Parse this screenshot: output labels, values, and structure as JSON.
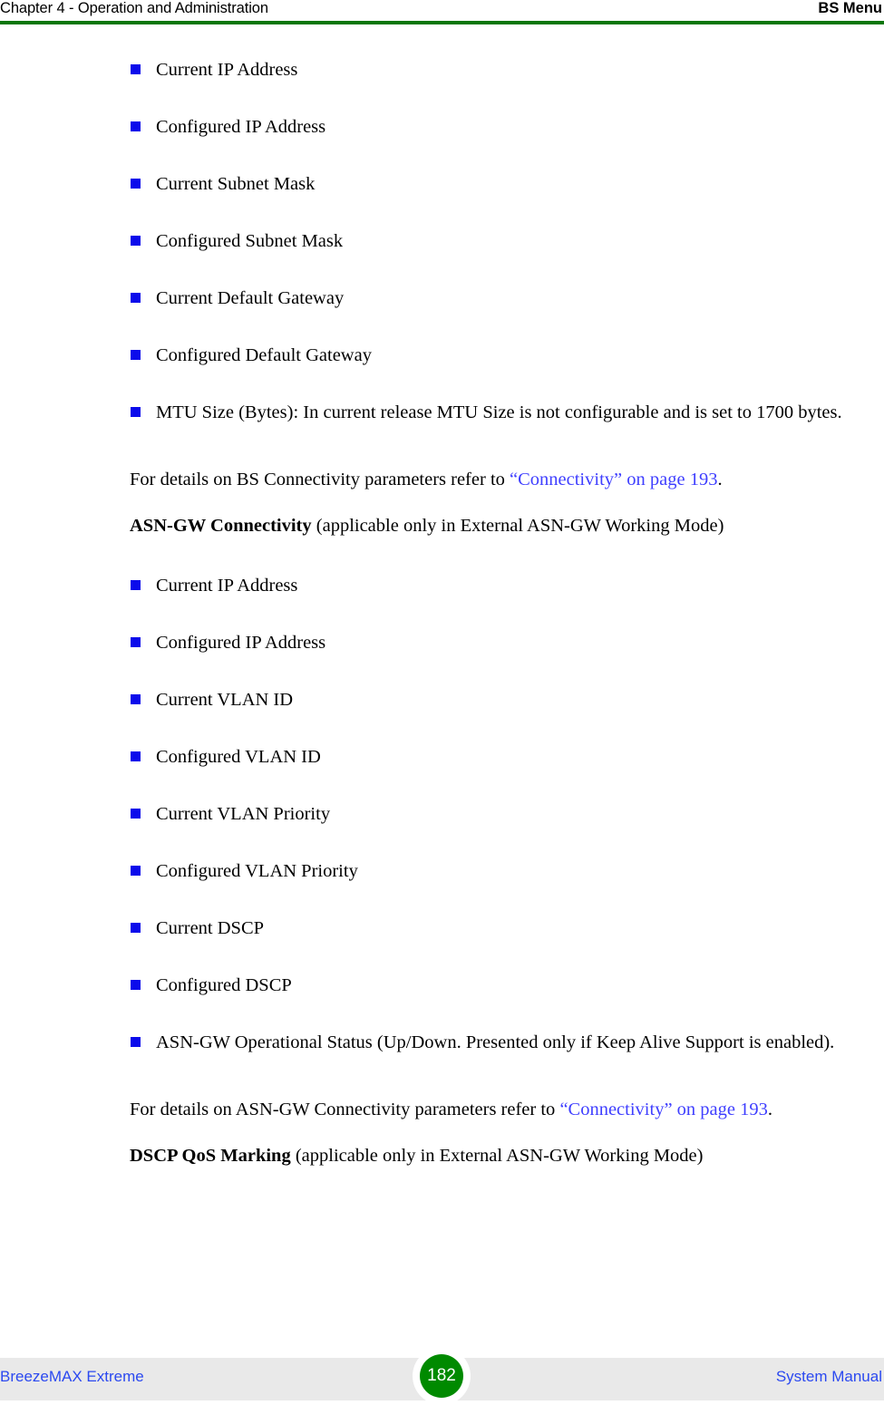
{
  "header": {
    "left": "Chapter 4 - Operation and Administration",
    "right": "BS Menu",
    "rule_color": "#097609"
  },
  "bullet_color": "#0b0beb",
  "link_color": "#3f3fff",
  "bs_connectivity": {
    "bullets": [
      "Current IP Address",
      "Configured IP Address",
      "Current Subnet Mask",
      "Configured Subnet Mask",
      "Current Default Gateway",
      "Configured Default Gateway",
      "MTU Size (Bytes): In current release MTU Size is not configurable and is set to 1700 bytes."
    ],
    "reference": {
      "lead": "For details on BS Connectivity parameters refer to ",
      "link": "“Connectivity” on page 193",
      "tail": "."
    }
  },
  "asn_gw_connectivity": {
    "heading_bold": "ASN-GW Connectivity",
    "heading_rest": " (applicable only in External ASN-GW Working Mode)",
    "bullets": [
      "Current IP Address",
      "Configured IP Address",
      "Current VLAN ID",
      "Configured VLAN ID",
      "Current VLAN Priority",
      "Configured VLAN Priority",
      "Current DSCP",
      "Configured DSCP",
      "ASN-GW Operational Status (Up/Down. Presented only if Keep Alive Support is enabled)."
    ],
    "reference": {
      "lead": "For details on ASN-GW Connectivity parameters refer to ",
      "link": "“Connectivity” on page 193",
      "tail": "."
    }
  },
  "dscp_qos_marking": {
    "heading_bold": "DSCP QoS Marking",
    "heading_rest": " (applicable only in External ASN-GW Working Mode)"
  },
  "footer": {
    "left": "BreezeMAX Extreme",
    "page_number": "182",
    "right": "System Manual",
    "badge_color": "#008a00",
    "band_color": "#e9e9e9"
  }
}
